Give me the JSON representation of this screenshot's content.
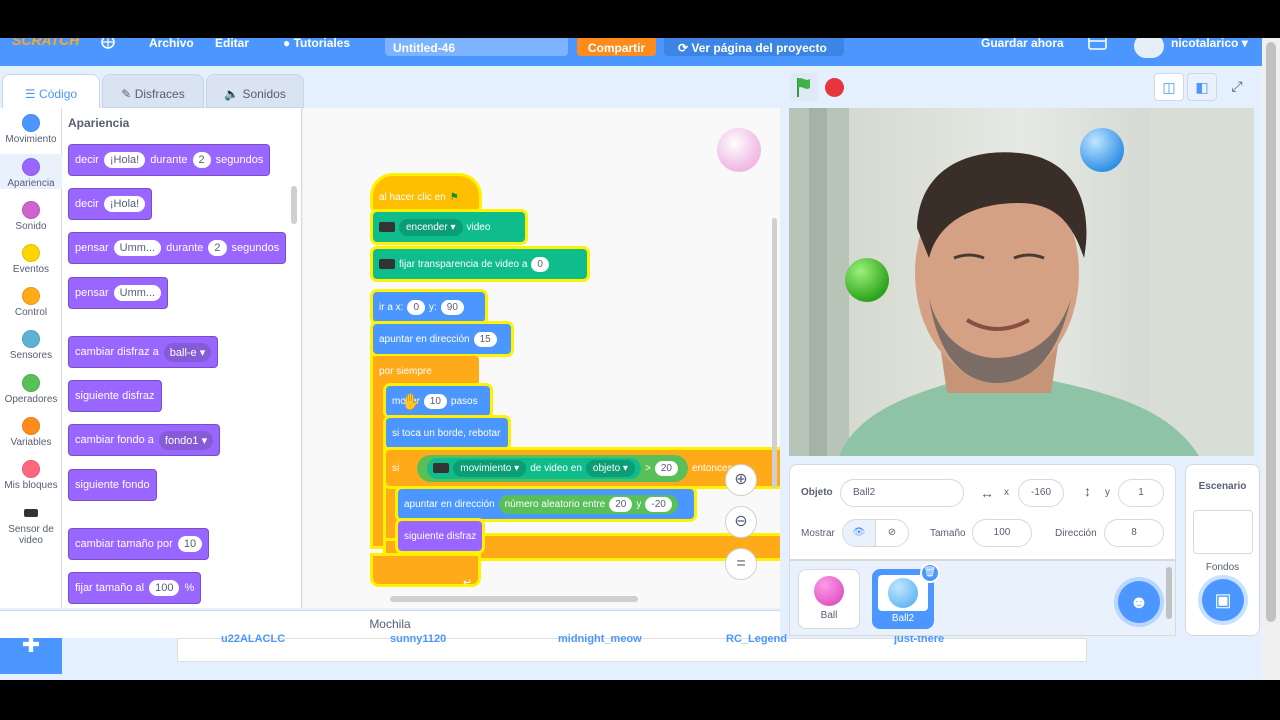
{
  "menu": {
    "logo": "SCRATCH",
    "globe_icon": "globe-icon",
    "file": "Archivo",
    "edit": "Editar",
    "tutorials": "Tutoriales",
    "project_title": "Untitled-46",
    "share": "Compartir",
    "view_project": "Ver página del proyecto",
    "save_now": "Guardar ahora",
    "username": "nicotalarico"
  },
  "tabs": [
    "Código",
    "Disfraces",
    "Sonidos"
  ],
  "categories": [
    {
      "label": "Movimiento",
      "color": "#4c97ff"
    },
    {
      "label": "Apariencia",
      "color": "#9966ff"
    },
    {
      "label": "Sonido",
      "color": "#cf63cf"
    },
    {
      "label": "Eventos",
      "color": "#ffd500"
    },
    {
      "label": "Control",
      "color": "#ffab19"
    },
    {
      "label": "Sensores",
      "color": "#5cb1d6"
    },
    {
      "label": "Operadores",
      "color": "#59c059"
    },
    {
      "label": "Variables",
      "color": "#ff8c1a"
    },
    {
      "label": "Mis bloques",
      "color": "#ff6680"
    },
    {
      "label": "Sensor de video",
      "color": "#0fbd8c"
    }
  ],
  "palette": {
    "title": "Apariencia",
    "blocks": [
      {
        "parts": [
          "decir",
          "¡Hola!",
          "durante",
          "2",
          "segundos"
        ]
      },
      {
        "parts": [
          "decir",
          "¡Hola!"
        ]
      },
      {
        "parts": [
          "pensar",
          "Umm...",
          "durante",
          "2",
          "segundos"
        ]
      },
      {
        "parts": [
          "pensar",
          "Umm..."
        ]
      },
      {
        "parts": [
          "cambiar disfraz a",
          "ball-e"
        ]
      },
      {
        "parts": [
          "siguiente disfraz"
        ]
      },
      {
        "parts": [
          "cambiar fondo a",
          "fondo1"
        ]
      },
      {
        "parts": [
          "siguiente fondo"
        ]
      },
      {
        "parts": [
          "cambiar tamaño por",
          "10"
        ]
      },
      {
        "parts": [
          "fijar tamaño al",
          "100",
          "%"
        ]
      }
    ]
  },
  "script": {
    "hat": "al hacer clic en",
    "video_on": {
      "dropdown": "encender",
      "text": "video"
    },
    "transparency": {
      "text": "fijar transparencia de video a",
      "value": "0"
    },
    "goto": {
      "text": "ir a x:",
      "x": "0",
      "y_label": "y:",
      "y": "90"
    },
    "point": {
      "text": "apuntar en dirección",
      "value": "15"
    },
    "forever": "por siempre",
    "move": {
      "text": "mover",
      "value": "10",
      "unit": "pasos"
    },
    "bounce": "si toca un borde, rebotar",
    "if": {
      "label": "si",
      "dropdown1": "movimiento",
      "mid": "de video en",
      "dropdown2": "objeto",
      "op": ">",
      "value": "20",
      "then": "entonces"
    },
    "random": {
      "text": "apuntar en dirección",
      "reporter": "número aleatorio entre",
      "a": "20",
      "and": "y",
      "b": "-20"
    },
    "next_costume": "siguiente disfraz"
  },
  "backpack": "Mochila",
  "background_names": [
    "u22ALACLC",
    "sunny1120",
    "midnight_meow",
    "RC_Legend",
    "just-there"
  ],
  "sprite_info": {
    "object_label": "Objeto",
    "object_name": "Ball2",
    "x_label": "x",
    "x": "-160",
    "y_label": "y",
    "y": "1",
    "show_label": "Mostrar",
    "size_label": "Tamaño",
    "size": "100",
    "direction_label": "Dirección",
    "direction": "8"
  },
  "sprites": [
    {
      "name": "Ball",
      "color": "#d63fb8"
    },
    {
      "name": "Ball2",
      "color": "#4aa8f0"
    }
  ],
  "stage_panel": {
    "title": "Escenario",
    "backdrops": "Fondos"
  }
}
